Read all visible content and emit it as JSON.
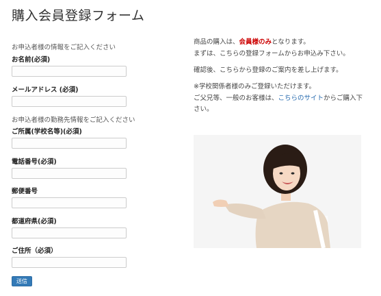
{
  "page": {
    "title": "購入会員登録フォーム"
  },
  "form": {
    "note_applicant": "お申込者様の情報をご記入ください",
    "name_label": "お名前(必須)",
    "name_value": "",
    "email_label": "メールアドレス (必須)",
    "email_value": "",
    "note_workplace": "お申込者様の勤務先情報をご記入ください",
    "affiliation_label": "ご所属(学校名等)(必須)",
    "affiliation_value": "",
    "phone_label": "電話番号(必須)",
    "phone_value": "",
    "postal_label": "郵便番号",
    "postal_value": "",
    "prefecture_label": "都道府県(必須)",
    "prefecture_value": "",
    "address_label": "ご住所（必須）",
    "address_value": "",
    "submit_label": "送信"
  },
  "info": {
    "line1_pre": "商品の購入は、",
    "line1_em": "会員様のみ",
    "line1_post": "となります。",
    "line2": "まずは、こちらの登録フォームからお申込み下さい。",
    "line3": "確認後、こちらから登録のご案内を差し上げます。",
    "line4": "※学校関係者様のみご登録いただけます。",
    "line5_pre": "ご父兄等、一般のお客様は、",
    "line5_link": "こちらのサイト",
    "line5_post": "からご購入下さい。"
  },
  "colors": {
    "accent_red": "#cc0000",
    "link_blue": "#2a6db0",
    "button_blue": "#337ab7"
  }
}
